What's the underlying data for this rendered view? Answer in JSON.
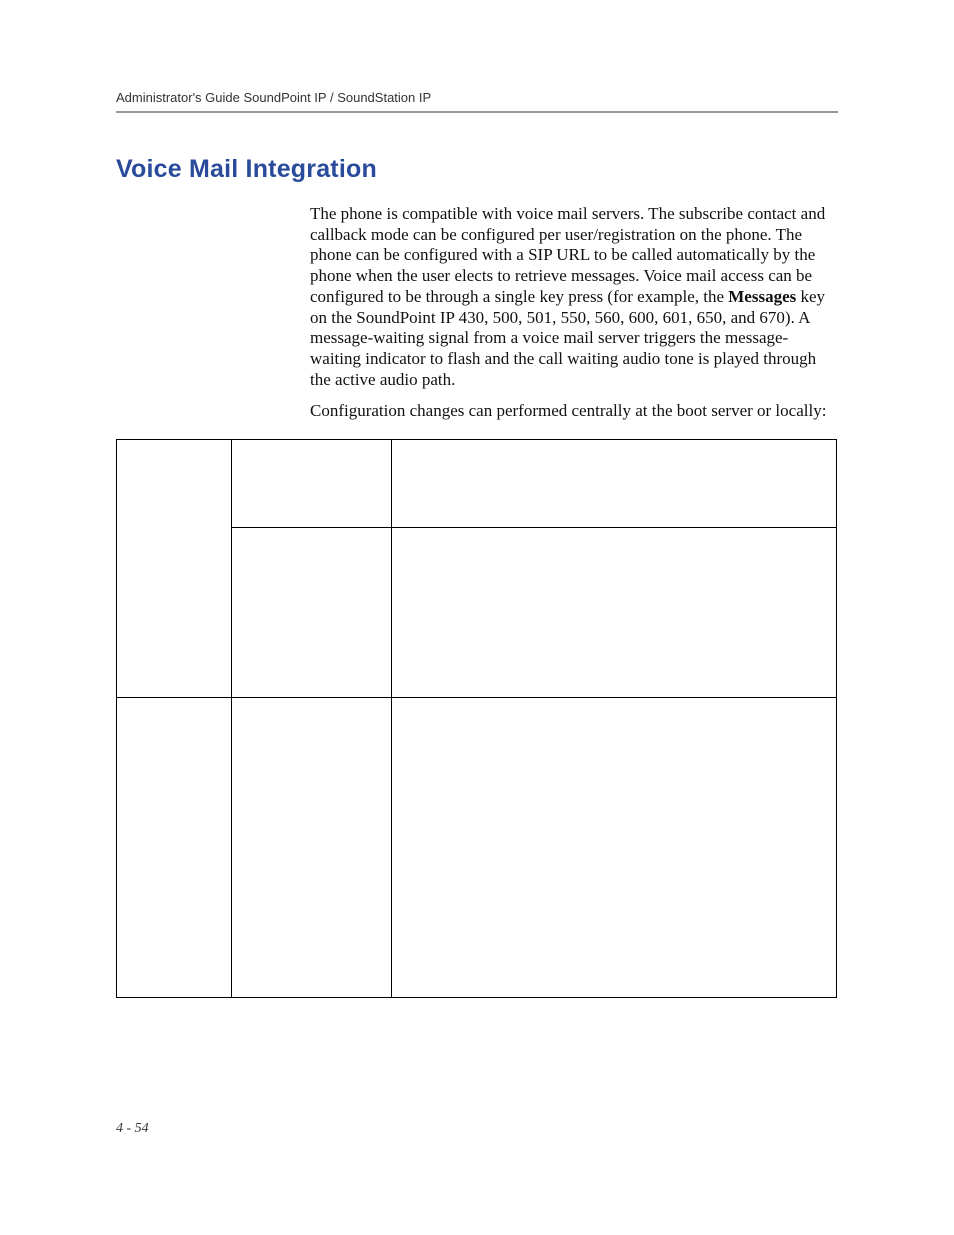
{
  "header": {
    "running_head": "Administrator's Guide SoundPoint IP / SoundStation IP"
  },
  "section": {
    "title": "Voice Mail Integration"
  },
  "body": {
    "p1_a": "The phone is compatible with voice mail servers. The subscribe contact and callback mode can be configured per user/registration on the phone. The phone can be configured with a SIP URL to be called automatically by the phone when the user elects to retrieve messages. Voice mail access can be configured to be through a single key press (for example, the ",
    "p1_bold": "Messages",
    "p1_b": " key on the SoundPoint IP 430, 500, 501, 550, 560, 600, 601, 650, and 670). A message-waiting signal from a voice mail server triggers the message-waiting indicator to flash and the call waiting audio tone is played through the active audio path.",
    "p2": "Configuration changes can performed centrally at the boot server or locally:"
  },
  "table": {
    "rows": [
      [
        "",
        "",
        ""
      ],
      [
        "",
        "",
        ""
      ],
      [
        "",
        "",
        ""
      ]
    ]
  },
  "footer": {
    "page_number": "4 - 54"
  }
}
